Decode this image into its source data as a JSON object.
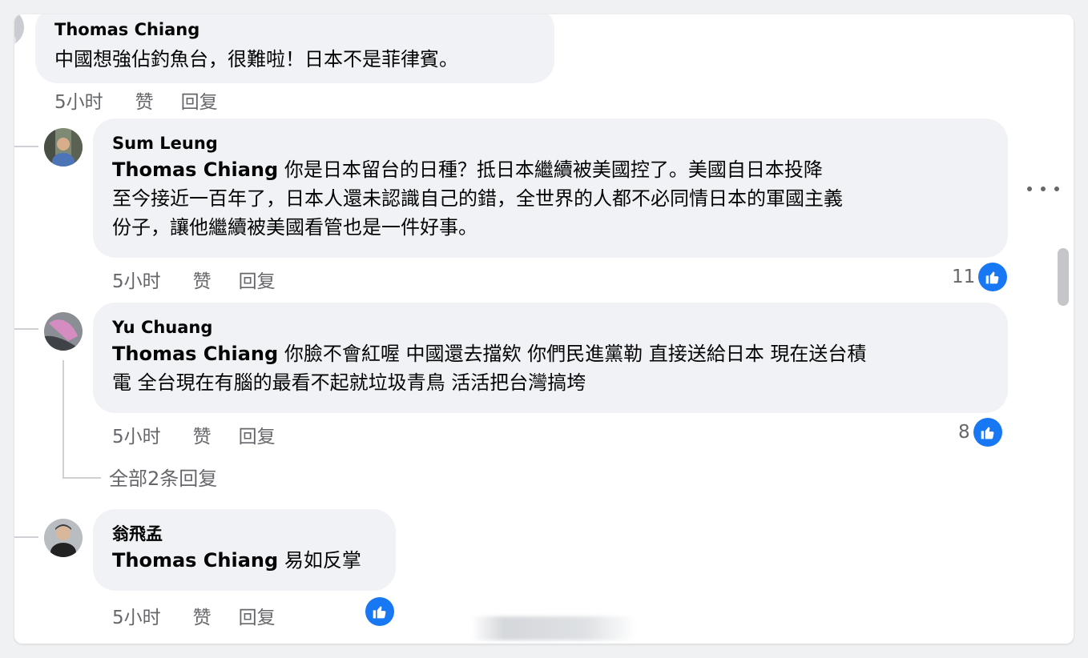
{
  "comments": [
    {
      "author": "Thomas Chiang",
      "text": "中國想強佔釣魚台，很難啦！日本不是菲律賓。",
      "time": "5小时",
      "like_label": "赞",
      "reply_label": "回复"
    },
    {
      "author": "Sum Leung",
      "mention": "Thomas Chiang",
      "lines": [
        " 你是日本留台的日種？抵日本繼續被美國控了。美國自日本投降",
        "至今接近一百年了，日本人還未認識自己的錯，全世界的人都不必同情日本的軍國主義",
        "份子，讓他繼續被美國看管也是一件好事。"
      ],
      "time": "5小时",
      "like_label": "赞",
      "reply_label": "回复",
      "reaction_count": "11"
    },
    {
      "author": "Yu Chuang",
      "mention": "Thomas Chiang",
      "lines": [
        " 你臉不會紅喔 中國還去擋欸 你們民進黨勒 直接送給日本 現在送台積",
        "電 全台現在有腦的最看不起就垃圾青鳥 活活把台灣搞垮"
      ],
      "time": "5小时",
      "like_label": "赞",
      "reply_label": "回复",
      "reaction_count": "8"
    },
    {
      "author": "翁飛孟",
      "mention": "Thomas Chiang",
      "text": " 易如反掌",
      "time": "5小时",
      "like_label": "赞",
      "reply_label": "回复"
    }
  ],
  "view_replies_label": "全部2条回复",
  "colors": {
    "like_blue": "#1877f2",
    "bubble_bg": "#f0f2f5",
    "meta_gray": "#65676b"
  },
  "icons": {
    "like": "thumbs-up-icon",
    "more": "more-horizontal-icon"
  }
}
